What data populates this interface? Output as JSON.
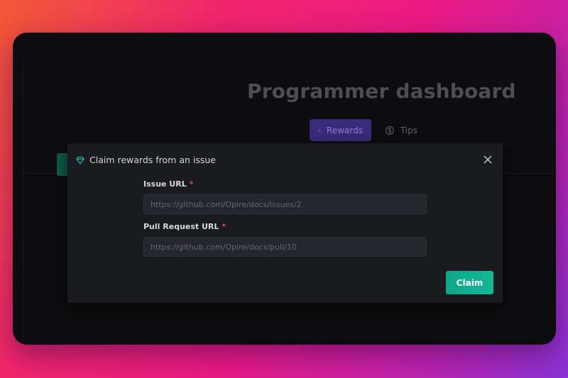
{
  "page": {
    "title": "Programmer dashboard"
  },
  "tabs": [
    {
      "label": "Rewards",
      "icon": "bag-icon",
      "active": true
    },
    {
      "label": "Tips",
      "icon": "dollar-coin-icon",
      "active": false
    }
  ],
  "modal": {
    "title": "Claim rewards from an issue",
    "title_icon": "diamond-icon",
    "close_icon": "close-icon",
    "fields": [
      {
        "label": "Issue URL",
        "required_mark": "*",
        "placeholder": "https://github.com/Opire/docs/issues/2",
        "value": ""
      },
      {
        "label": "Pull Request URL",
        "required_mark": "*",
        "placeholder": "https://github.com/Opire/docs/pull/10",
        "value": ""
      }
    ],
    "submit_label": "Claim"
  },
  "colors": {
    "accent_green": "#12b895",
    "active_tab": "#3a2a7a",
    "required": "#e0495d",
    "modal_bg": "#1a1b1e"
  }
}
